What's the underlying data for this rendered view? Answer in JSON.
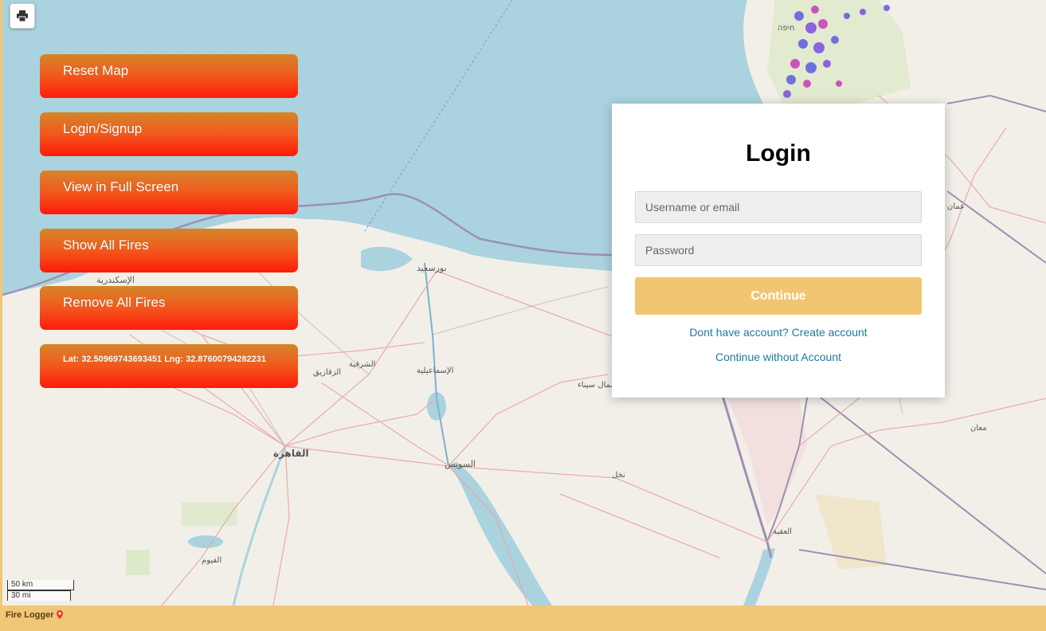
{
  "controls": {
    "print_icon": "printer-icon",
    "reset_map": "Reset Map",
    "login_signup": "Login/Signup",
    "full_screen": "View in Full Screen",
    "show_all_fires": "Show All Fires",
    "remove_all_fires": "Remove All Fires",
    "coordinates": "Lat: 32.50969743693451 Lng: 32.87600794282231"
  },
  "login": {
    "title": "Login",
    "username_placeholder": "Username or email",
    "password_placeholder": "Password",
    "continue_label": "Continue",
    "create_account_link": "Dont have account? Create account",
    "continue_without_account_link": "Continue without Account"
  },
  "scale": {
    "metric": "50 km",
    "imperial": "30 mi"
  },
  "footer": {
    "app_name": "Fire Logger",
    "logo_icon": "map-pin-icon"
  },
  "colors": {
    "accent": "#f0c777",
    "button_top": "#d4862a",
    "button_bottom": "#ff1a0a",
    "link": "#1a7aa0",
    "sea": "#aad3df",
    "land": "#f2efe9"
  },
  "map_labels": {
    "cairo": "القاهرة",
    "alexandria": "الإسكندرية",
    "port_said": "بورسعيد",
    "suez": "السويس",
    "ismailia": "الإسماعيلية",
    "zagazig": "الزقازيق",
    "north_sinai": "شمال سيناء",
    "aqaba": "العقبة",
    "amman": "عمان",
    "maan": "معان",
    "haifa": "חיפה",
    "fayoum": "الفيوم",
    "sharqia": "الشرقية",
    "nakhl": "نخل"
  }
}
